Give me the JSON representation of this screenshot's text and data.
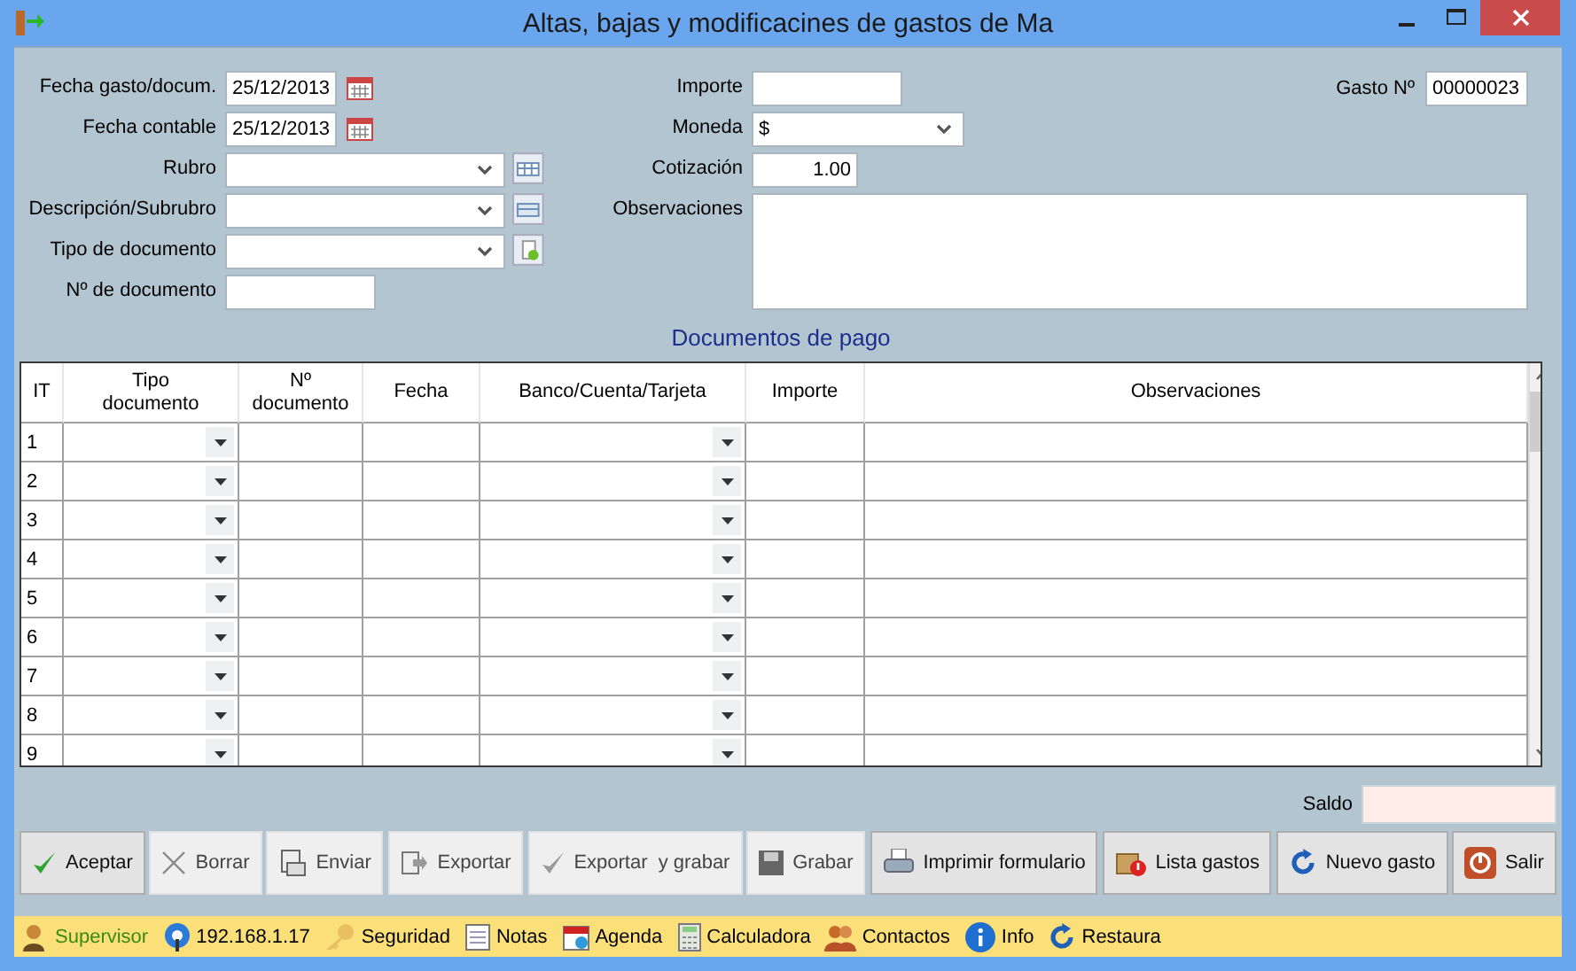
{
  "window": {
    "title": "Altas, bajas y modificacines de gastos de Ma"
  },
  "form": {
    "left": [
      {
        "label": "Fecha gasto/docum.",
        "kind": "date",
        "value": "25/12/2013"
      },
      {
        "label": "Fecha contable",
        "kind": "date",
        "value": "25/12/2013"
      },
      {
        "label": "Rubro",
        "kind": "combo"
      },
      {
        "label": "Descripción/Subrubro",
        "kind": "combo"
      },
      {
        "label": "Tipo de documento",
        "kind": "combo"
      },
      {
        "label": "Nº de documento",
        "kind": "text"
      }
    ],
    "right": [
      {
        "label": "Importe",
        "kind": "text"
      },
      {
        "label": "Moneda",
        "kind": "combo",
        "value": "$"
      },
      {
        "label": "Cotización",
        "kind": "number",
        "value": "1.00"
      },
      {
        "label": "Observaciones",
        "kind": "memo"
      }
    ],
    "gasto": {
      "label": "Gasto Nº",
      "value": "00000023"
    }
  },
  "payments": {
    "title": "Documentos de pago",
    "columns": [
      {
        "label": "IT",
        "kind": "index"
      },
      {
        "label": "Tipo documento",
        "kind": "combo"
      },
      {
        "label": "Nº documento",
        "kind": "text"
      },
      {
        "label": "Fecha",
        "kind": "text"
      },
      {
        "label": "Banco/Cuenta/Tarjeta",
        "kind": "combo"
      },
      {
        "label": "Importe",
        "kind": "text"
      },
      {
        "label": "Observaciones",
        "kind": "text"
      }
    ],
    "rows": [
      {
        "it": "1"
      },
      {
        "it": "2"
      },
      {
        "it": "3"
      },
      {
        "it": "4"
      },
      {
        "it": "5"
      },
      {
        "it": "6"
      },
      {
        "it": "7"
      },
      {
        "it": "8"
      },
      {
        "it": "9"
      }
    ]
  },
  "saldo": {
    "label": "Saldo"
  },
  "buttons": [
    {
      "label": "Aceptar",
      "disabled": false
    },
    {
      "label": "Borrar",
      "disabled": true
    },
    {
      "label": "Enviar",
      "disabled": true
    },
    {
      "label": "Exportar",
      "disabled": true
    },
    {
      "label": "Exportar  y grabar",
      "disabled": true
    },
    {
      "label": "Grabar",
      "disabled": true
    },
    {
      "label": "Imprimir formulario",
      "disabled": false
    },
    {
      "label": "Lista gastos",
      "disabled": false
    },
    {
      "label": "Nuevo gasto",
      "disabled": false
    },
    {
      "label": "Salir",
      "disabled": false
    }
  ],
  "status_bar": [
    {
      "label": "Supervisor",
      "color": "#3a8a12"
    },
    {
      "label": "192.168.1.17",
      "color": "#000000"
    },
    {
      "label": "Seguridad",
      "color": "#000000"
    },
    {
      "label": "Notas",
      "color": "#000000"
    },
    {
      "label": "Agenda",
      "color": "#000000"
    },
    {
      "label": "Calculadora",
      "color": "#000000"
    },
    {
      "label": "Contactos",
      "color": "#000000"
    },
    {
      "label": "Info",
      "color": "#000000"
    },
    {
      "label": "Restaura",
      "color": "#000000"
    }
  ]
}
